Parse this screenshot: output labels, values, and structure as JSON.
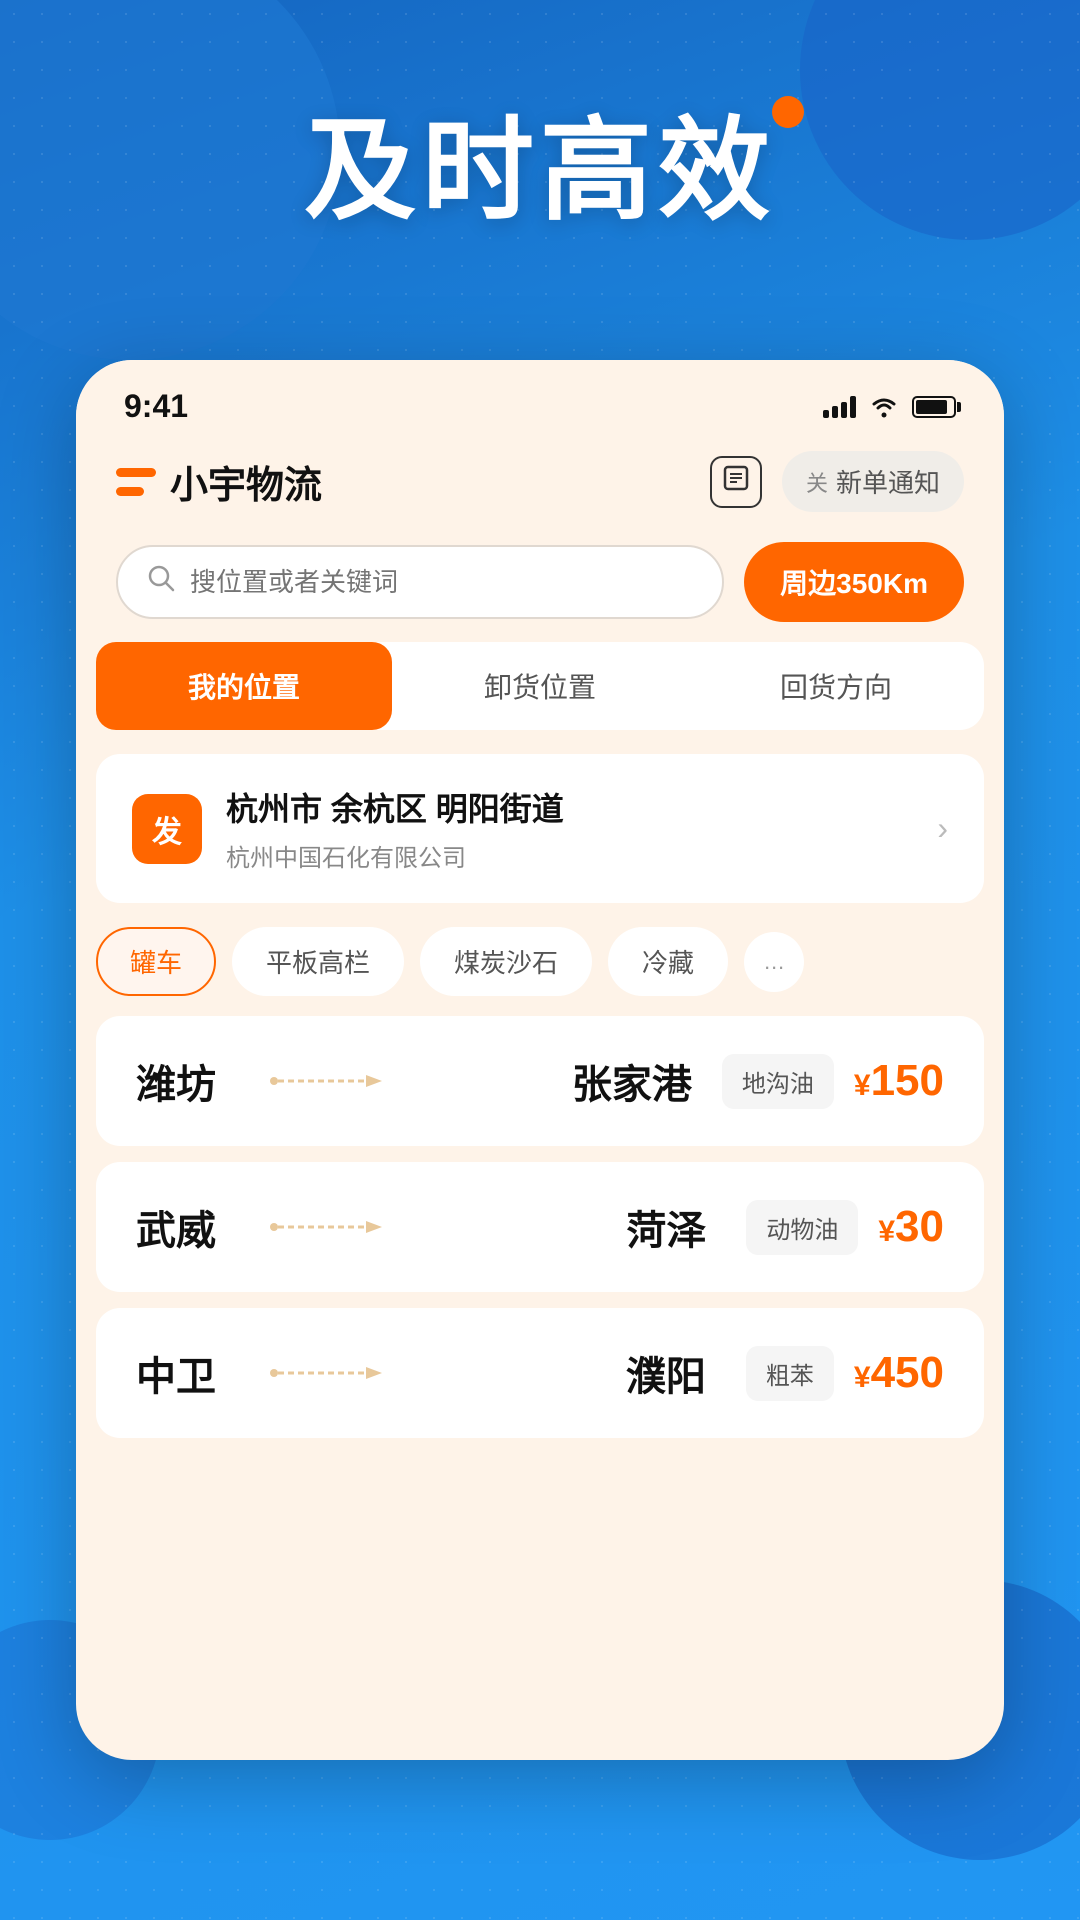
{
  "background": {
    "color": "#1a7ad4"
  },
  "hero": {
    "title": "及时高效",
    "orange_dot": true
  },
  "status_bar": {
    "time": "9:41",
    "signal": 4,
    "wifi": true,
    "battery": 85
  },
  "header": {
    "logo_text": "小宇物流",
    "doc_icon": "≡",
    "notification_close_label": "关",
    "notification_label": "新单通知"
  },
  "search": {
    "placeholder": "搜位置或者关键词",
    "nearby_btn": "周边350Km"
  },
  "tabs": [
    {
      "label": "我的位置",
      "active": true
    },
    {
      "label": "卸货位置",
      "active": false
    },
    {
      "label": "回货方向",
      "active": false
    }
  ],
  "location": {
    "badge": "发",
    "main_text": "杭州市 余杭区 明阳街道",
    "sub_text": "杭州中国石化有限公司"
  },
  "filters": [
    {
      "label": "罐车",
      "active": true
    },
    {
      "label": "平板高栏",
      "active": false
    },
    {
      "label": "煤炭沙石",
      "active": false
    },
    {
      "label": "冷藏",
      "active": false
    }
  ],
  "freight_list": [
    {
      "origin": "潍坊",
      "dest": "张家港",
      "cargo": "地沟油",
      "price": "¥150"
    },
    {
      "origin": "武威",
      "dest": "菏泽",
      "cargo": "动物油",
      "price": "¥30"
    },
    {
      "origin": "中卫",
      "dest": "濮阳",
      "cargo": "粗苯",
      "price": "¥450"
    }
  ]
}
